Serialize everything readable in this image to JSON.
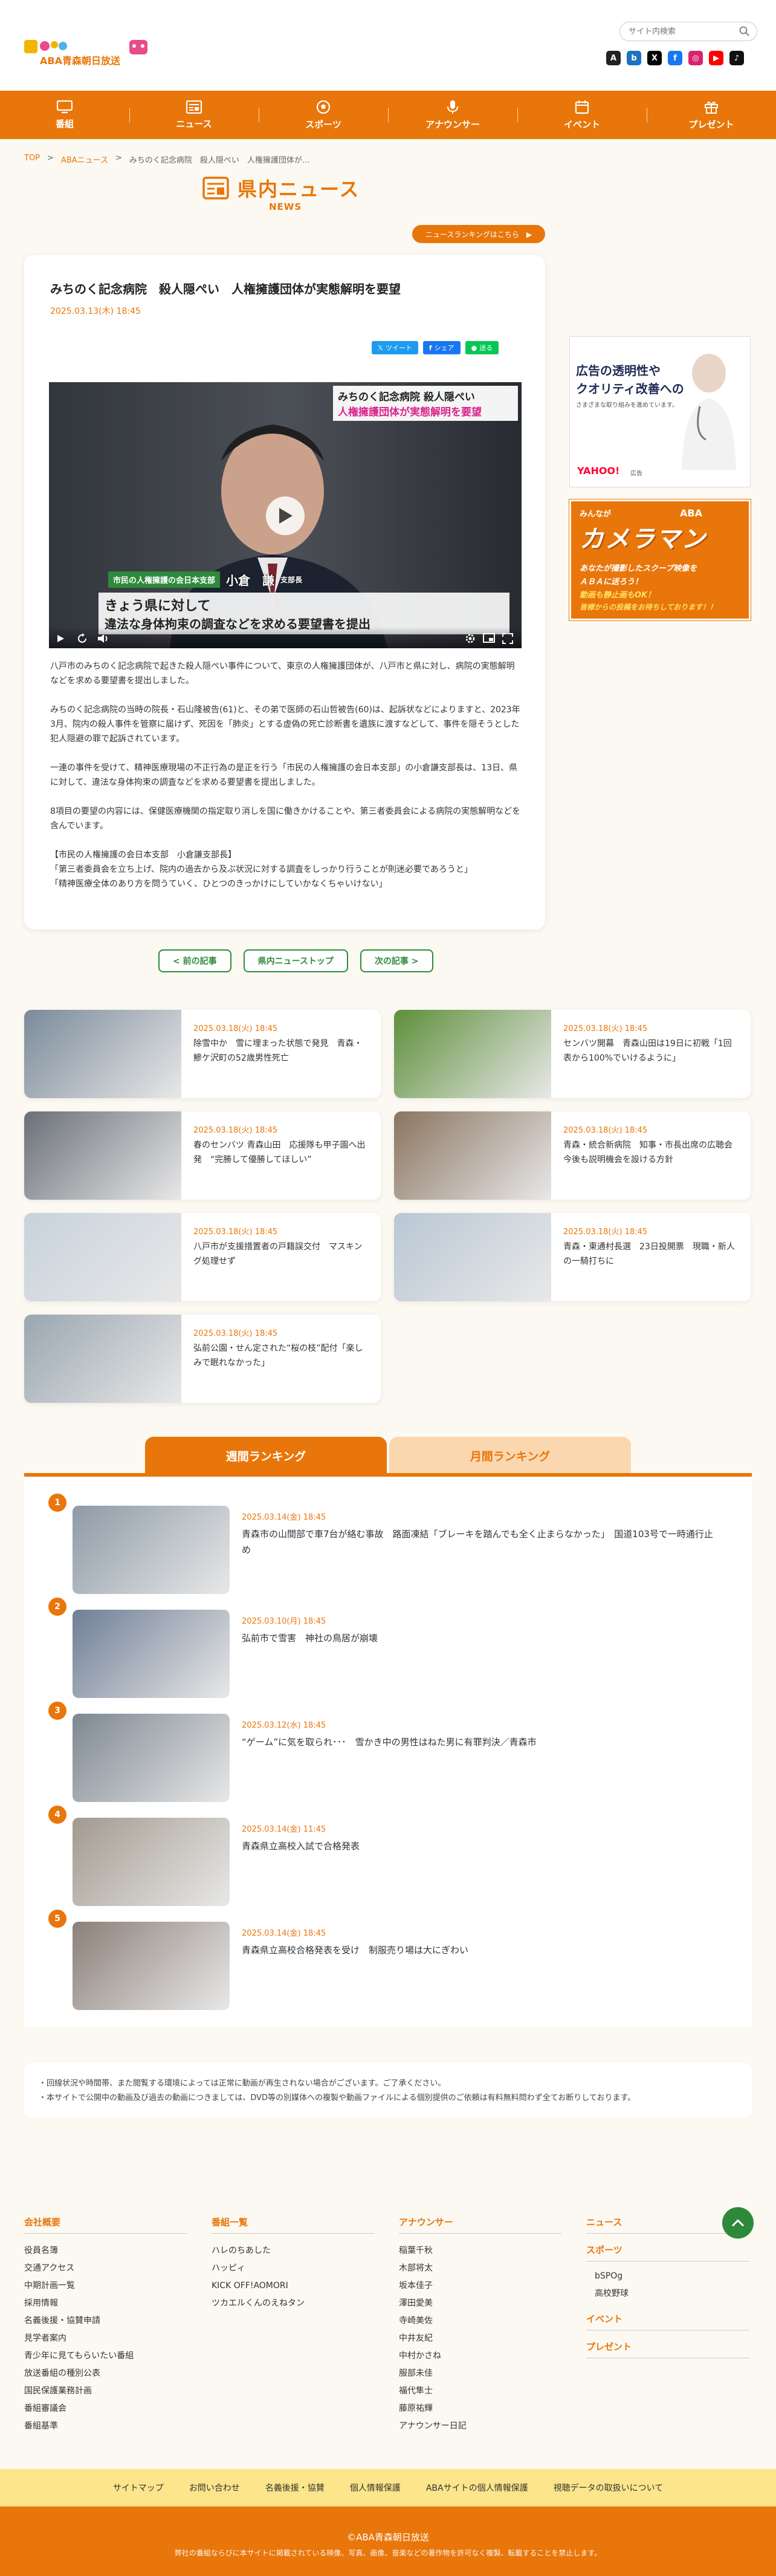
{
  "header": {
    "logo_text": "ABA青森朝日放送",
    "search_placeholder": "サイト内検索",
    "social": [
      {
        "name": "aba-icon",
        "label": "A",
        "color": "#222222"
      },
      {
        "name": "b-icon",
        "label": "b",
        "color": "#1e73be"
      },
      {
        "name": "x-icon",
        "label": "X",
        "color": "#000000"
      },
      {
        "name": "facebook-icon",
        "label": "f",
        "color": "#1877f2"
      },
      {
        "name": "instagram-icon",
        "label": "◎",
        "color": "#d6246e"
      },
      {
        "name": "youtube-icon",
        "label": "▶",
        "color": "#ff0000"
      },
      {
        "name": "tiktok-icon",
        "label": "♪",
        "color": "#111111"
      }
    ]
  },
  "nav": [
    {
      "label": "番組",
      "icon": "tv-icon"
    },
    {
      "label": "ニュース",
      "icon": "newspaper-icon"
    },
    {
      "label": "スポーツ",
      "icon": "ball-icon"
    },
    {
      "label": "アナウンサー",
      "icon": "mic-icon"
    },
    {
      "label": "イベント",
      "icon": "calendar-icon"
    },
    {
      "label": "プレゼント",
      "icon": "gift-icon"
    }
  ],
  "breadcrumb": {
    "top": "TOP",
    "sep": ">",
    "news": "ABAニュース",
    "current": "みちのく記念病院　殺人隠ぺい　人権擁護団体が…"
  },
  "section": {
    "title": "県内ニュース",
    "subtitle": "NEWS",
    "ranking_link": "ニュースランキングはこちら　▶"
  },
  "article": {
    "title": "みちのく記念病院　殺人隠ぺい　人権擁護団体が実態解明を要望",
    "date": "2025.03.13(木) 18:45",
    "share": {
      "x": "ツイート",
      "fb": "シェア",
      "line": "送る"
    },
    "video": {
      "top_caption_1": "みちのく記念病院 殺人隠ぺい",
      "top_caption_2": "人権擁護団体が実態解明を要望",
      "name_tag_left": "市民の人権擁護の会日本支部",
      "name_tag_name": "小倉　謙",
      "name_tag_role": "支部長",
      "subtitle_1": "きょう県に対して",
      "subtitle_2": "違法な身体拘束の調査などを求める要望書を提出"
    },
    "paragraphs": [
      "八戸市のみちのく記念病院で起きた殺人隠ぺい事件について、東京の人権擁護団体が、八戸市と県に対し、病院の実態解明などを求める要望書を提出しました。",
      "みちのく記念病院の当時の院長・石山隆被告(61)と、その弟で医師の石山哲被告(60)は、起訴状などによりますと、2023年3月、院内の殺人事件を管察に届けず、死因を「肺炎」とする虚偽の死亡診断書を遺族に渡すなどして、事件を隠そうとした犯人隠避の罪で起訴されています。",
      "一連の事件を受けて、精神医療現場の不正行為の是正を行う「市民の人権擁護の会日本支部」の小倉謙支部長は、13日、県に対して、違法な身体拘束の調査などを求める要望書を提出しました。",
      "8項目の要望の内容には、保健医療機関の指定取り消しを国に働きかけることや、第三者委員会による病院の実態解明などを含んでいます。"
    ],
    "quote_head": "【市民の人権擁護の会日本支部　小倉謙支部長】",
    "quote_lines": [
      "「第三者委員会を立ち上げ、院内の過去から及ぶ状況に対する調査をしっかり行うことが則迷必要であろうと」",
      "「精神医療全体のあり方を問うていく、ひとつのきっかけにしていかなくちゃいけない」"
    ]
  },
  "ads": {
    "yahoo_line1": "広告の透明性や",
    "yahoo_line2": "クオリティ改善への",
    "yahoo_line3": "さまざまな取り組みを進めています。",
    "yahoo_brand": "YAHOO!",
    "yahoo_sub": "広告",
    "cam_small": "みんなが",
    "cam_brand": "ABA",
    "cam_title": "カメラマン",
    "cam_line1": "あなたが撮影したスクープ映像を",
    "cam_line2": "ＡＢＡに送ろう！",
    "cam_line3": "動画も静止画もOK！",
    "cam_line4": "皆様からの投稿をお待ちしております！！"
  },
  "pager": {
    "prev": "< 前の記事",
    "list": "県内ニューストップ",
    "next": "次の記事 >"
  },
  "related": [
    {
      "date": "2025.03.18(火) 18:45",
      "title": "除雪中か　雪に埋まった状態で発見　青森・鰺ケ沢町の52歳男性死亡",
      "thumb": "#7a8a9a"
    },
    {
      "date": "2025.03.18(火) 18:45",
      "title": "センバツ開幕　青森山田は19日に初戦「1回表から100%でいけるように」",
      "thumb": "#5d8f3a"
    },
    {
      "date": "2025.03.18(火) 18:45",
      "title": "春のセンバツ 青森山田　応援隊も甲子園へ出発　“完勝して優勝してほしい”",
      "thumb": "#6a6f78"
    },
    {
      "date": "2025.03.18(火) 18:45",
      "title": "青森・統合新病院　知事・市長出席の広聴会　今後も説明機会を設ける方針",
      "thumb": "#8a7560"
    },
    {
      "date": "2025.03.18(火) 18:45",
      "title": "八戸市が支援措置者の戸籍誤交付　マスキング処理せず",
      "thumb": "#c8d2dc"
    },
    {
      "date": "2025.03.18(火) 18:45",
      "title": "青森・東通村長選　23日投開票　現職・新人の一騎打ちに",
      "thumb": "#b9c7d4"
    },
    {
      "date": "2025.03.18(火) 18:45",
      "title": "弘前公園・せん定された“桜の枝”配付「楽しみで眠れなかった」",
      "thumb": "#9aa6b0"
    }
  ],
  "ranking": {
    "tab_weekly": "週間ランキング",
    "tab_monthly": "月間ランキング",
    "items": [
      {
        "rank": "1",
        "date": "2025.03.14(金) 18:45",
        "title": "青森市の山間部で車7台が絡む事故　路面凍結「ブレーキを踏んでも全く止まらなかった」　国道103号で一時通行止め",
        "thumb": "#8d9aa6"
      },
      {
        "rank": "2",
        "date": "2025.03.10(月) 18:45",
        "title": "弘前市で雪害　神社の鳥居が崩壊",
        "thumb": "#6f7f96"
      },
      {
        "rank": "3",
        "date": "2025.03.12(水) 18:45",
        "title": "“ゲーム”に気を取られ･･･　雪かき中の男性はねた男に有罪判決／青森市",
        "thumb": "#7d8791"
      },
      {
        "rank": "4",
        "date": "2025.03.14(金) 11:45",
        "title": "青森県立高校入試で合格発表",
        "thumb": "#a39a8f"
      },
      {
        "rank": "5",
        "date": "2025.03.14(金) 18:45",
        "title": "青森県立高校合格発表を受け　制服売り場は大にぎわい",
        "thumb": "#8c8079"
      }
    ]
  },
  "notice": [
    "・回線状況や時間帯、また閲覧する環境によっては正常に動画が再生されない場合がございます。ご了承ください。",
    "・本サイトで公開中の動画及び過去の動画につきましては、DVD等の別媒体への複製や動画ファイルによる個別提供のご依頼は有料無料問わず全てお断りしております。"
  ],
  "footer": {
    "company_head": "会社概要",
    "company": [
      "役員名簿",
      "交通アクセス",
      "中期計画一覧",
      "採用情報",
      "名義後援・協賛申請",
      "見学者案内",
      "青少年に見てもらいたい番組",
      "放送番組の種別公表",
      "国民保護業務計画",
      "番組審議会",
      "番組基準"
    ],
    "programs_head": "番組一覧",
    "programs": [
      "ハレのちあした",
      "ハッピィ",
      "KICK OFF!AOMORI",
      "ツカエルくんのえねタン"
    ],
    "announcer_head": "アナウンサー",
    "announcers": [
      "稲葉千秋",
      "木部将太",
      "坂本佳子",
      "澤田愛美",
      "寺崎美佐",
      "中井友紀",
      "中村かさね",
      "服部未佳",
      "福代隼士",
      "藤原祐輝",
      "アナウンサー日記"
    ],
    "news_head": "ニュース",
    "sports_head": "スポーツ",
    "sports": [
      "bSPOg",
      "高校野球"
    ],
    "event_head": "イベント",
    "present_head": "プレゼント"
  },
  "footer_links": [
    "サイトマップ",
    "お問い合わせ",
    "名義後援・協賛",
    "個人情報保護",
    "ABAサイトの個人情報保護",
    "視聴データの取扱いについて"
  ],
  "copyright": "©ABA青森朝日放送",
  "copyright_sub": "弊社の番組ならびに本サイトに掲載されている映像、写真、画像、音楽などの著作物を許可なく複製、転載することを禁止します。",
  "colors": {
    "accent": "#e9760a",
    "green": "#2d8a3a",
    "yellow": "#fce58a"
  }
}
